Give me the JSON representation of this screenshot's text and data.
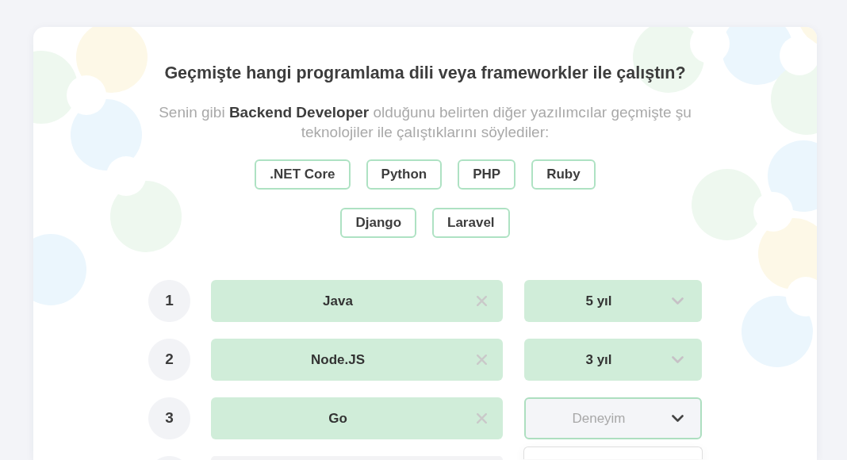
{
  "question": {
    "title": "Geçmişte hangi programlama dili veya frameworkler ile çalıştın?",
    "subtitle": "Senin gibi **Backend Developer** olduğunu belirten diğer yazılımcılar geçmişte şu teknolojiler ile çalıştıklarını söylediler:"
  },
  "suggestions": [
    ".NET Core",
    "Python",
    "PHP",
    "Ruby",
    "Django",
    "Laravel"
  ],
  "rows": [
    {
      "number": "1",
      "technology": {
        "value": "Java",
        "filled": true
      },
      "experience": {
        "value": "5 yıl",
        "expanded": false
      }
    },
    {
      "number": "2",
      "technology": {
        "value": "Node.JS",
        "filled": true
      },
      "experience": {
        "value": "3 yıl",
        "expanded": false
      }
    },
    {
      "number": "3",
      "technology": {
        "value": "Go",
        "filled": true
      },
      "experience": {
        "placeholder": "Deneyim",
        "expanded": true
      }
    },
    {
      "technology": {
        "filled": false
      }
    }
  ]
}
